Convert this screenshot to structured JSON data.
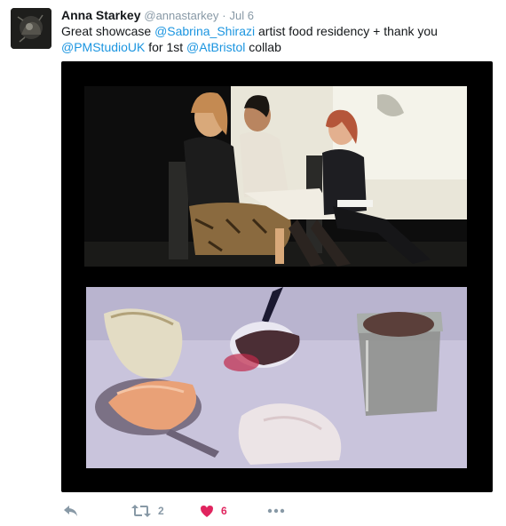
{
  "tweet": {
    "author": {
      "name": "Anna Starkey",
      "handle": "@annastarkey",
      "separator": "·",
      "date": "Jul 6"
    },
    "text_parts": {
      "p1": "Great showcase ",
      "m1": "@Sabrina_Shirazi",
      "p2": " artist food residency + thank you ",
      "m2": "@PMStudioUK",
      "p3": " for 1st ",
      "m3": "@AtBristol",
      "p4": " collab"
    },
    "media": [
      {
        "name": "panel-discussion-photo",
        "description_icon": "photo"
      },
      {
        "name": "food-tasting-photo",
        "description_icon": "photo"
      }
    ],
    "actions": {
      "reply_icon": "reply-icon",
      "retweet_icon": "retweet-icon",
      "retweet_count": "2",
      "like_icon": "heart-icon",
      "like_count": "6",
      "more_icon": "more-icon"
    },
    "colors": {
      "link": "#1b95e0",
      "muted": "#8899a6",
      "like": "#e0245e"
    }
  }
}
